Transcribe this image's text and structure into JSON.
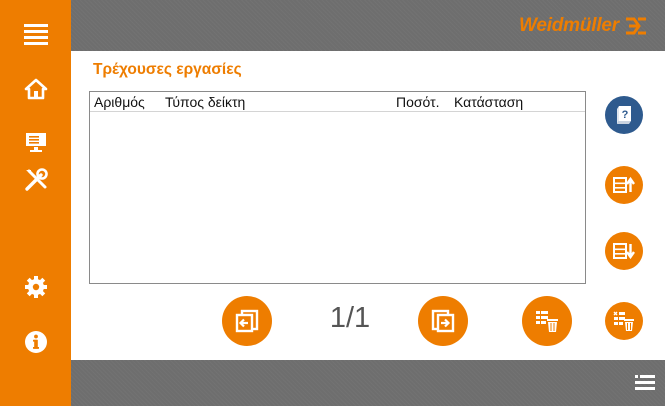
{
  "header": {
    "brand": "Weidmüller",
    "brand_color": "#ee7d00"
  },
  "sidebar": {
    "items": [
      {
        "name": "menu",
        "icon": "hamburger-menu-icon"
      },
      {
        "name": "home",
        "icon": "home-icon"
      },
      {
        "name": "display",
        "icon": "monitor-icon"
      },
      {
        "name": "tools",
        "icon": "tools-icon"
      },
      {
        "name": "settings",
        "icon": "gear-icon"
      },
      {
        "name": "info",
        "icon": "info-icon"
      }
    ]
  },
  "main": {
    "title": "Τρέχουσες εργασίες",
    "table": {
      "columns": [
        "Αριθμός",
        "Τύπος δείκτη",
        "Ποσότ.",
        "Κατάσταση"
      ],
      "rows": []
    },
    "pager": "1/1"
  },
  "right_actions": [
    {
      "name": "help",
      "icon": "help-book-icon"
    },
    {
      "name": "move-up",
      "icon": "move-job-up-icon"
    },
    {
      "name": "move-down",
      "icon": "move-job-down-icon"
    },
    {
      "name": "delete-selected",
      "icon": "delete-selected-icon"
    }
  ],
  "bottom_actions": [
    {
      "name": "previous-page",
      "icon": "previous-page-icon"
    },
    {
      "name": "next-page",
      "icon": "next-page-icon"
    },
    {
      "name": "delete-all",
      "icon": "delete-all-icon"
    }
  ],
  "footer": {
    "icon": "job-list-icon"
  },
  "colors": {
    "accent": "#ee7d00",
    "bar_gray": "#6e6e6e",
    "help_blue": "#2e5a8e"
  }
}
